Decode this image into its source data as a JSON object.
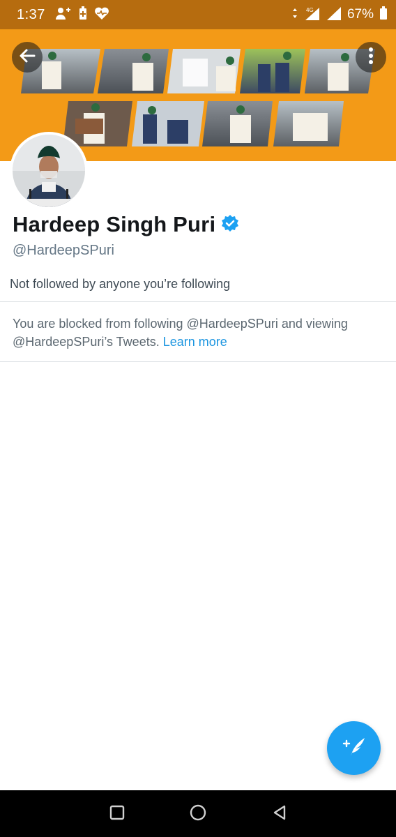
{
  "status_bar": {
    "time": "1:37",
    "battery_percent": "67%",
    "network": "4G"
  },
  "profile": {
    "display_name": "Hardeep Singh Puri",
    "handle": "@HardeepSPuri",
    "verified": true,
    "followed_by_text": "Not followed by anyone you’re following"
  },
  "blocked": {
    "message": "You are blocked from following @HardeepSPuri and viewing @HardeepSPuri’s Tweets.",
    "learn_more_label": "Learn more"
  },
  "icons": {
    "back": "arrow-left-icon",
    "more": "more-vertical-icon",
    "verified": "verified-badge-icon",
    "compose": "compose-tweet-icon"
  },
  "colors": {
    "status_bar": "#b66c0f",
    "banner": "#f39a17",
    "accent": "#1da1f2",
    "link": "#1b95e0"
  }
}
